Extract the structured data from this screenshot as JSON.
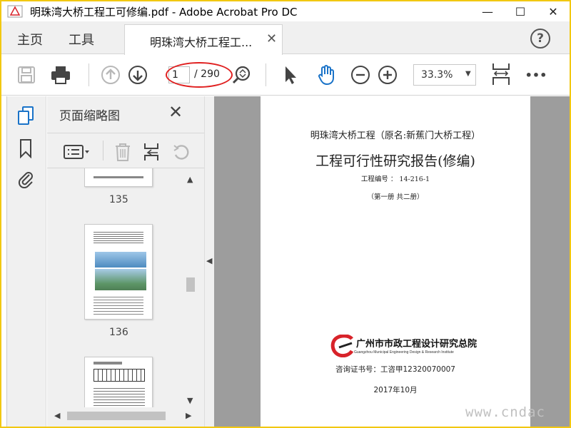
{
  "window": {
    "title": "明珠湾大桥工程工可修编.pdf - Adobe Acrobat Pro DC",
    "minimize": "—",
    "maximize": "☐",
    "close": "✕"
  },
  "tabs": {
    "home": "主页",
    "tools": "工具",
    "document": "明珠湾大桥工程工...",
    "document_close": "✕",
    "help": "?"
  },
  "toolbar": {
    "page_current": "1",
    "page_total": "/ 290",
    "zoom": "33.3%",
    "more": "•••"
  },
  "panel": {
    "title": "页面缩略图",
    "close": "✕",
    "thumbnails": [
      {
        "page": "135"
      },
      {
        "page": "136"
      }
    ]
  },
  "document": {
    "subtitle": "明珠湾大桥工程（原名:新蕉门大桥工程）",
    "title": "工程可行性研究报告(修编)",
    "project_no": "工程编号 ： 14-216-1",
    "volume": "（第一册 共二册）",
    "institute_cn": "广州市市政工程设计研究总院",
    "institute_en": "Guangzhou Municipal Engineering Design & Research Institute",
    "certificate": "咨询证书号：工咨甲12320070007",
    "date": "2017年10月"
  },
  "watermark": "www.cndac",
  "colors": {
    "accent_blue": "#1a73c8",
    "annotation_red": "#e02020",
    "logo_red": "#d8232a",
    "border_yellow": "#f2c811"
  }
}
